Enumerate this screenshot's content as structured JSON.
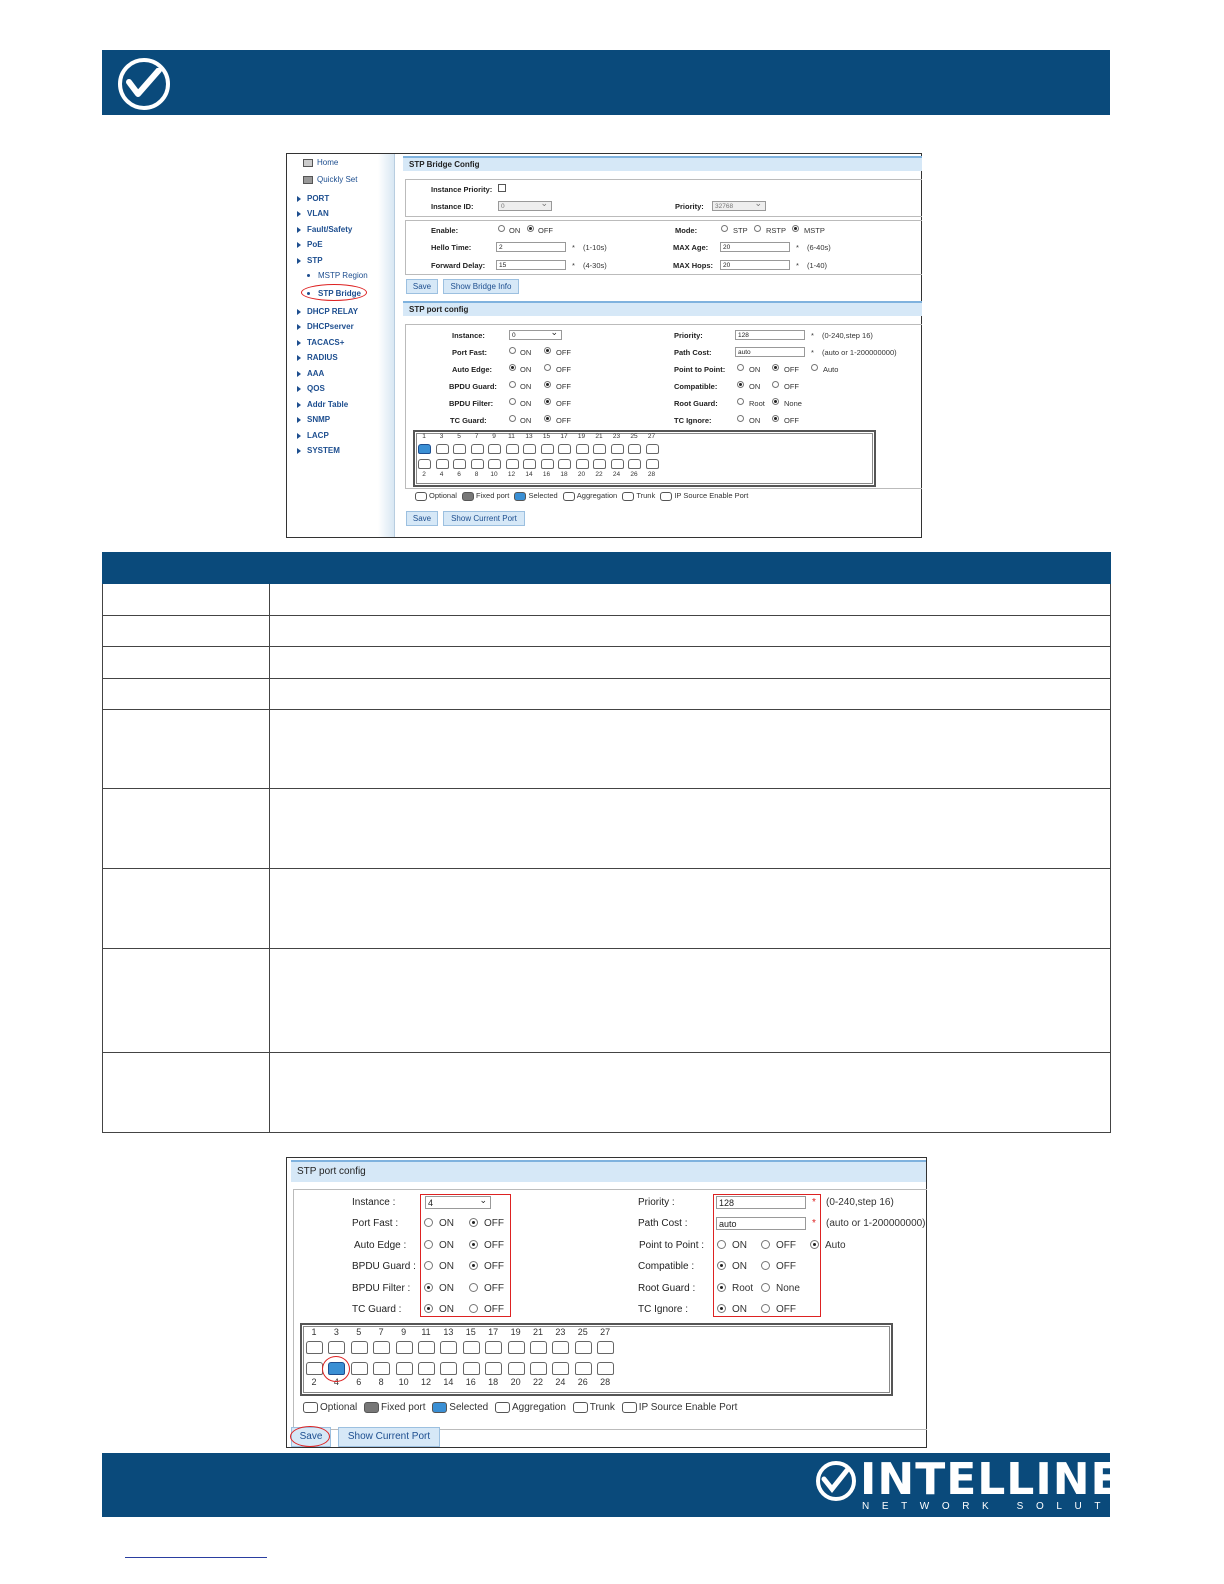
{
  "screenshot1": {
    "sidebar": {
      "items": [
        {
          "label": "Home",
          "type": "icon"
        },
        {
          "label": "Quickly Set",
          "type": "icon"
        },
        {
          "label": "PORT"
        },
        {
          "label": "VLAN"
        },
        {
          "label": "Fault/Safety"
        },
        {
          "label": "PoE"
        },
        {
          "label": "STP"
        },
        {
          "label": "MSTP Region",
          "type": "sub"
        },
        {
          "label": "STP Bridge",
          "type": "sub-selected"
        },
        {
          "label": "DHCP RELAY"
        },
        {
          "label": "DHCPserver"
        },
        {
          "label": "TACACS+"
        },
        {
          "label": "RADIUS"
        },
        {
          "label": "AAA"
        },
        {
          "label": "QOS"
        },
        {
          "label": "Addr Table"
        },
        {
          "label": "SNMP"
        },
        {
          "label": "LACP"
        },
        {
          "label": "SYSTEM"
        }
      ]
    },
    "bridge_config": {
      "title": "STP Bridge Config",
      "instance_priority_label": "Instance Priority:",
      "instance_id_label": "Instance ID:",
      "instance_id_value": "0",
      "priority_label": "Priority:",
      "priority_value": "32768",
      "enable_label": "Enable:",
      "on": "ON",
      "off": "OFF",
      "mode_label": "Mode:",
      "mode_stp": "STP",
      "mode_rstp": "RSTP",
      "mode_mstp": "MSTP",
      "hello_time_label": "Hello Time:",
      "hello_time_value": "2",
      "hello_time_range": "(1-10s)",
      "max_age_label": "MAX Age:",
      "max_age_value": "20",
      "max_age_range": "(6-40s)",
      "forward_delay_label": "Forward Delay:",
      "forward_delay_value": "15",
      "forward_delay_range": "(4-30s)",
      "max_hops_label": "MAX Hops:",
      "max_hops_value": "20",
      "max_hops_range": "(1-40)",
      "star": "*",
      "save": "Save",
      "show_bridge_info": "Show Bridge Info"
    },
    "port_config": {
      "title": "STP port config",
      "instance_label": "Instance:",
      "instance_value": "0",
      "port_fast_label": "Port Fast:",
      "auto_edge_label": "Auto Edge:",
      "bpdu_guard_label": "BPDU Guard:",
      "bpdu_filter_label": "BPDU Filter:",
      "tc_guard_label": "TC Guard:",
      "priority_label": "Priority:",
      "priority_value": "128",
      "priority_range": "(0-240,step 16)",
      "path_cost_label": "Path Cost:",
      "path_cost_value": "auto",
      "path_cost_range": "(auto or 1-200000000)",
      "p2p_label": "Point to Point:",
      "compatible_label": "Compatible:",
      "root_guard_label": "Root Guard:",
      "tc_ignore_label": "TC Ignore:",
      "on": "ON",
      "off": "OFF",
      "auto": "Auto",
      "root": "Root",
      "none": "None",
      "star": "*",
      "save": "Save",
      "show_current_port": "Show Current Port"
    },
    "ports_top": [
      "1",
      "3",
      "5",
      "7",
      "9",
      "11",
      "13",
      "15",
      "17",
      "19",
      "21",
      "23",
      "25",
      "27"
    ],
    "ports_bottom": [
      "2",
      "4",
      "6",
      "8",
      "10",
      "12",
      "14",
      "16",
      "18",
      "20",
      "22",
      "24",
      "26",
      "28"
    ],
    "legend": {
      "optional": "Optional",
      "fixed": "Fixed port",
      "selected": "Selected",
      "aggregation": "Aggregation",
      "trunk": "Trunk",
      "ip_source": "IP Source Enable Port"
    }
  },
  "screenshot2": {
    "title": "STP port config",
    "instance_label": "Instance :",
    "instance_value": "4",
    "port_fast_label": "Port Fast :",
    "auto_edge_label": "Auto Edge :",
    "bpdu_guard_label": "BPDU Guard :",
    "bpdu_filter_label": "BPDU Filter :",
    "tc_guard_label": "TC Guard :",
    "priority_label": "Priority :",
    "priority_value": "128",
    "priority_range": "(0-240,step 16)",
    "path_cost_label": "Path Cost :",
    "path_cost_value": "auto",
    "path_cost_range": "(auto or 1-200000000)",
    "p2p_label": "Point to Point :",
    "compatible_label": "Compatible :",
    "root_guard_label": "Root Guard :",
    "tc_ignore_label": "TC Ignore :",
    "on": "ON",
    "off": "OFF",
    "auto": "Auto",
    "root": "Root",
    "none": "None",
    "star": "*",
    "save": "Save",
    "show_current_port": "Show Current Port",
    "legend": {
      "optional": "Optional",
      "fixed": "Fixed port",
      "selected": "Selected",
      "aggregation": "Aggregation",
      "trunk": "Trunk",
      "ip_source": "IP Source Enable Port"
    }
  },
  "brand": {
    "logo_name": "INTELLINET",
    "logo_tagline": "NETWORK SOLUTIONS",
    "header_color": "#0a4a7b"
  }
}
